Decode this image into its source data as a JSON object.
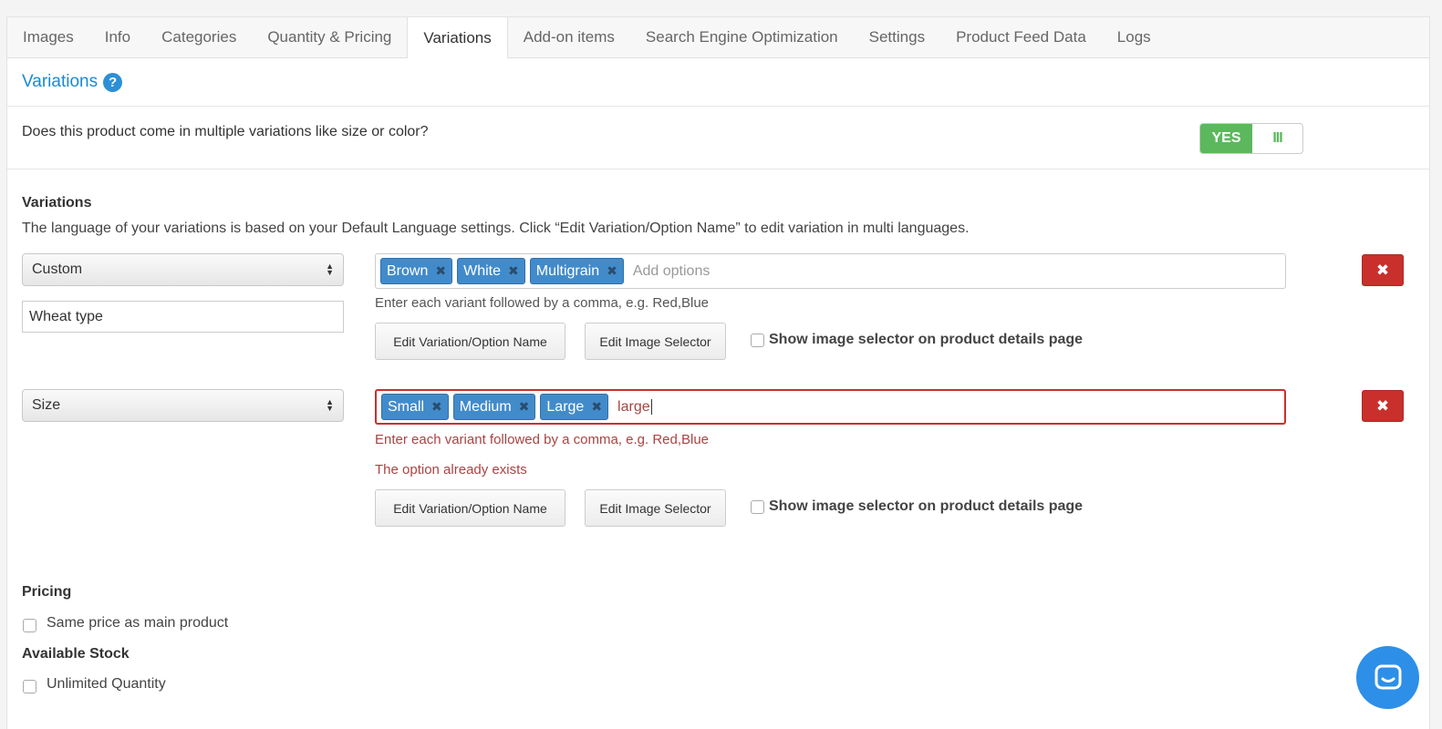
{
  "tabs": [
    "Images",
    "Info",
    "Categories",
    "Quantity & Pricing",
    "Variations",
    "Add-on items",
    "Search Engine Optimization",
    "Settings",
    "Product Feed Data",
    "Logs"
  ],
  "active_tab": "Variations",
  "section": {
    "title": "Variations",
    "help_icon": "?"
  },
  "question": "Does this product come in multiple variations like size or color?",
  "toggle": {
    "yes_label": "YES",
    "handle_label": "III",
    "state": "on"
  },
  "variations": {
    "heading": "Variations",
    "description": "The language of your variations is based on your Default Language settings. Click “Edit Variation/Option Name” to edit variation in multi languages.",
    "rows": [
      {
        "type": "Custom",
        "custom_name": "Wheat type",
        "tags": [
          "Brown",
          "White",
          "Multigrain"
        ],
        "input_placeholder": "Add options",
        "hint": "Enter each variant followed by a comma, e.g. Red,Blue",
        "edit_name_label": "Edit Variation/Option Name",
        "edit_image_label": "Edit Image Selector",
        "show_selector_label": "Show image selector on product details page",
        "delete_icon": "✖"
      },
      {
        "type": "Size",
        "tags": [
          "Small",
          "Medium",
          "Large"
        ],
        "input_value": "large",
        "hint": "Enter each variant followed by a comma, e.g. Red,Blue",
        "error": "The option already exists",
        "edit_name_label": "Edit Variation/Option Name",
        "edit_image_label": "Edit Image Selector",
        "show_selector_label": "Show image selector on product details page",
        "delete_icon": "✖"
      }
    ]
  },
  "pricing": {
    "heading": "Pricing",
    "same_price_label": "Same price as main product"
  },
  "stock": {
    "heading": "Available Stock",
    "unlimited_label": "Unlimited Quantity"
  },
  "colors": {
    "accent": "#1a8ad4",
    "tag": "#428bca",
    "error": "#a94442",
    "delete": "#c9302c",
    "toggle_on": "#5cb85c"
  }
}
